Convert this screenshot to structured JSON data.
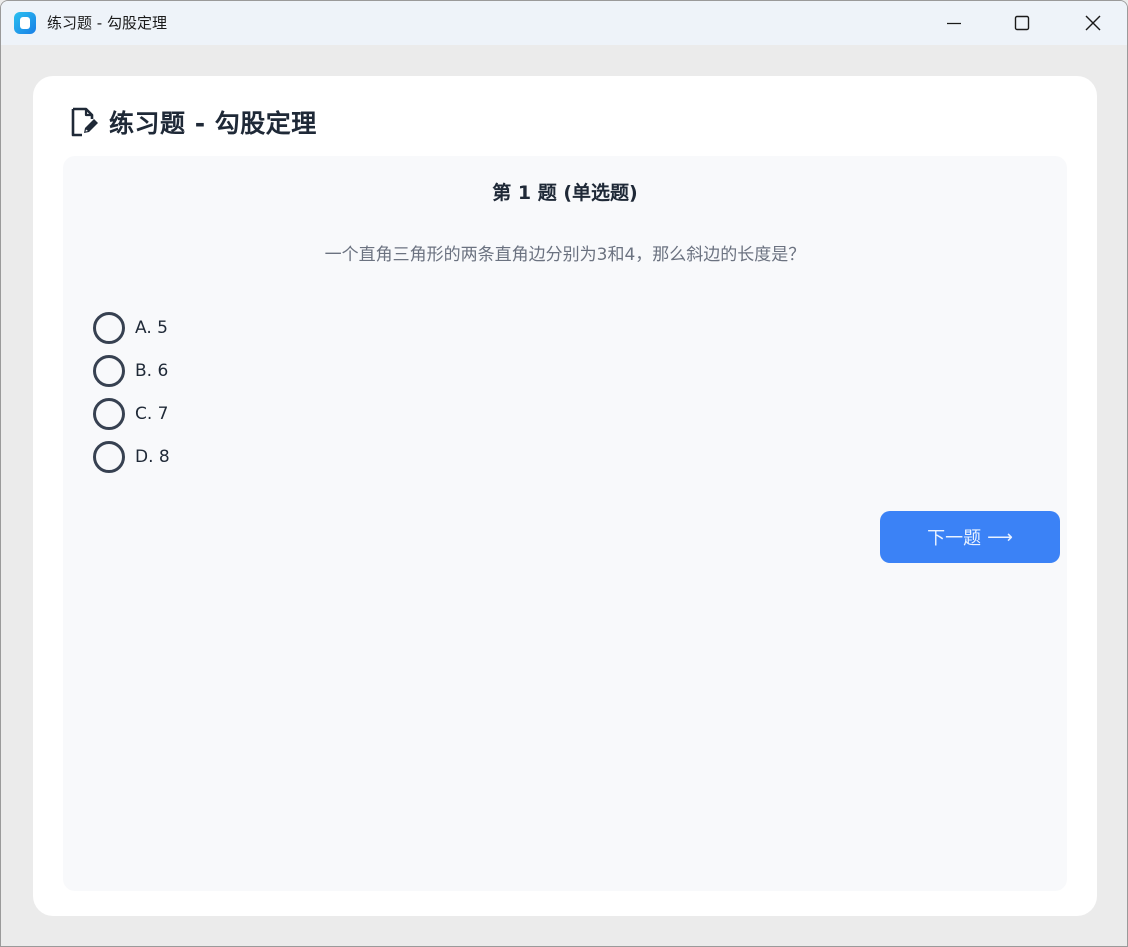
{
  "window": {
    "title": "练习题 - 勾股定理",
    "controls": {
      "minimize": "minimize-icon",
      "maximize": "maximize-icon",
      "close": "close-icon"
    }
  },
  "page": {
    "title": "练习题 - 勾股定理",
    "title_icon": "edit-document-icon"
  },
  "question": {
    "header": "第 1 题 (单选题)",
    "text": "一个直角三角形的两条直角边分别为3和4，那么斜边的长度是？",
    "options": [
      {
        "label": "A. 5",
        "selected": false
      },
      {
        "label": "B. 6",
        "selected": false
      },
      {
        "label": "C. 7",
        "selected": false
      },
      {
        "label": "D. 8",
        "selected": false
      }
    ]
  },
  "actions": {
    "next_label": "下一题",
    "next_icon": "arrow-right-icon"
  },
  "colors": {
    "accent": "#3b82f6",
    "panel_bg": "#f8f9fb",
    "text_primary": "#1f2937",
    "text_secondary": "#6b7280"
  }
}
